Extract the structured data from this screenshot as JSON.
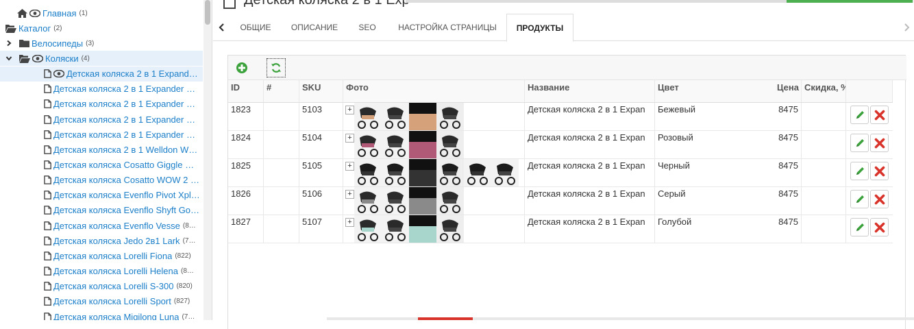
{
  "sidebar": {
    "nodes": [
      {
        "label": "Главная",
        "count": "(1)"
      },
      {
        "label": "Каталог",
        "count": "(2)"
      },
      {
        "label": "Велосипеды",
        "count": "(3)"
      },
      {
        "label": "Коляски",
        "count": "(4)"
      },
      {
        "label": "Детская коляска 2 в 1 Expand…",
        "count": ""
      },
      {
        "label": "Детская коляска 2 в 1 Expander …",
        "count": ""
      },
      {
        "label": "Детская коляска 2 в 1 Expander …",
        "count": ""
      },
      {
        "label": "Детская коляска 2 в 1 Expander …",
        "count": ""
      },
      {
        "label": "Детская коляска 2 в 1 Expander …",
        "count": ""
      },
      {
        "label": "Детская коляска 2 в 1 Welldon W…",
        "count": ""
      },
      {
        "label": "Детская коляска Cosatto Giggle …",
        "count": ""
      },
      {
        "label": "Детская коляска Cosatto WOW 2 …",
        "count": ""
      },
      {
        "label": "Детская коляска Evenflo Pivot Xpl…",
        "count": ""
      },
      {
        "label": "Детская коляска Evenflo Shyft Go…",
        "count": ""
      },
      {
        "label": "Детская коляска Evenflo Vesse",
        "count": "(8…"
      },
      {
        "label": "Детская коляска Jedo 2в1 Lark",
        "count": "(7…"
      },
      {
        "label": "Детская коляска Lorelli Fiona",
        "count": "(822)"
      },
      {
        "label": "Детская коляска Lorelli Helena",
        "count": "(8…"
      },
      {
        "label": "Детская коляска Lorelli S-300",
        "count": "(820)"
      },
      {
        "label": "Детская коляска Lorelli Sport",
        "count": "(827)"
      },
      {
        "label": "Детская коляска Migilong Luna",
        "count": "(7…"
      }
    ]
  },
  "header": {
    "title_fragment": "Детская коляска 2 в 1 Exp"
  },
  "tabs": [
    {
      "label": "ОБЩИЕ"
    },
    {
      "label": "ОПИСАНИЕ"
    },
    {
      "label": "SEO"
    },
    {
      "label": "НАСТРОЙКА СТРАНИЦЫ"
    },
    {
      "label": "ПРОДУКТЫ"
    }
  ],
  "active_tab": "ПРОДУКТЫ",
  "grid": {
    "columns": [
      "ID",
      "#",
      "SKU",
      "Фото",
      "Название",
      "Цвет",
      "Цена",
      "Скидка, %"
    ],
    "rows": [
      {
        "id": "1823",
        "num": "",
        "sku": "5103",
        "photo_count": 4,
        "name": "Детская коляска 2 в 1 Expan",
        "color": "Бежевый",
        "price": "8475"
      },
      {
        "id": "1824",
        "num": "",
        "sku": "5104",
        "photo_count": 4,
        "name": "Детская коляска 2 в 1 Expan",
        "color": "Розовый",
        "price": "8475"
      },
      {
        "id": "1825",
        "num": "",
        "sku": "5105",
        "photo_count": 6,
        "name": "Детская коляска 2 в 1 Expan",
        "color": "Черный",
        "price": "8475"
      },
      {
        "id": "1826",
        "num": "",
        "sku": "5106",
        "photo_count": 4,
        "name": "Детская коляска 2 в 1 Expan",
        "color": "Серый",
        "price": "8475"
      },
      {
        "id": "1827",
        "num": "",
        "sku": "5107",
        "photo_count": 4,
        "name": "Детская коляска 2 в 1 Expan",
        "color": "Голубой",
        "price": "8475"
      }
    ],
    "expand_label": "+"
  },
  "colors": {
    "link": "#1a7ec9",
    "accent_green": "#4caf50",
    "danger": "#d9342b"
  }
}
